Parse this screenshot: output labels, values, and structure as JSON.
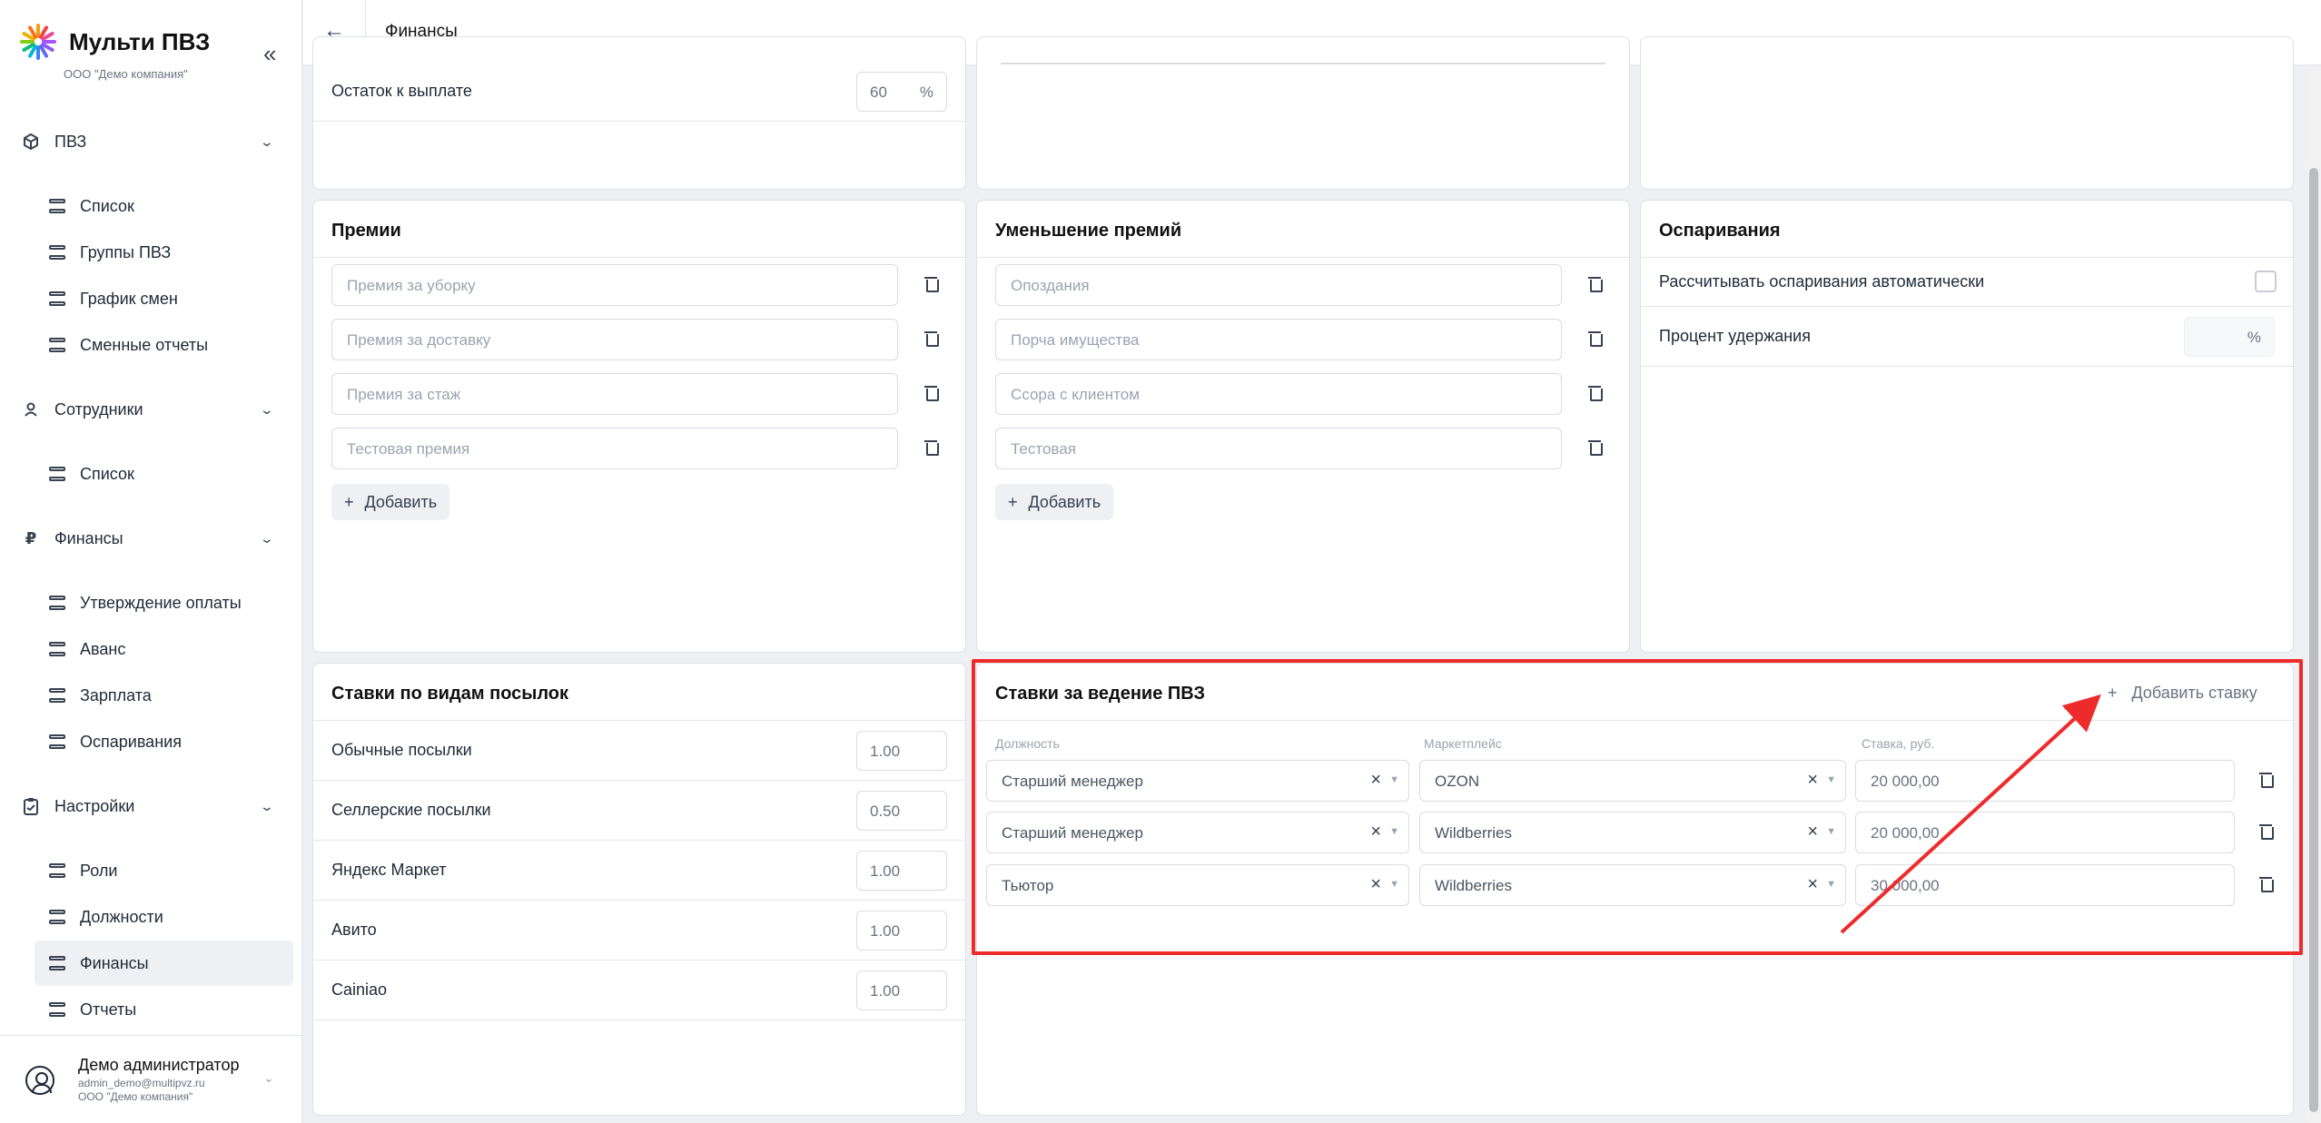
{
  "app": {
    "name": "Мульти ПВЗ",
    "company": "ООО \"Демо компания\"",
    "collapse_icon": "«"
  },
  "sidebar": {
    "sections": [
      {
        "label": "ПВЗ",
        "icon": "cube-icon",
        "items": [
          "Список",
          "Группы ПВЗ",
          "График смен",
          "Сменные отчеты"
        ]
      },
      {
        "label": "Сотрудники",
        "icon": "person-icon",
        "items": [
          "Список"
        ]
      },
      {
        "label": "Финансы",
        "icon": "ruble-icon",
        "items": [
          "Утверждение оплаты",
          "Аванс",
          "Зарплата",
          "Оспаривания"
        ]
      },
      {
        "label": "Настройки",
        "icon": "clipboard-icon",
        "items": [
          "Роли",
          "Должности",
          "Финансы",
          "Отчеты"
        ]
      }
    ],
    "active_item": "Финансы",
    "user": {
      "name": "Демо администратор",
      "email": "admin_demo@multipvz.ru",
      "company": "ООО \"Демо компания\""
    }
  },
  "header": {
    "title": "Финансы"
  },
  "payout_card": {
    "label": "Остаток к выплате",
    "value": "60",
    "unit": "%"
  },
  "bonuses_card": {
    "title": "Премии",
    "items": [
      "Премия за уборку",
      "Премия за доставку",
      "Премия за стаж",
      "Тестовая премия"
    ],
    "add_label": "Добавить"
  },
  "reductions_card": {
    "title": "Уменьшение премий",
    "items": [
      "Опоздания",
      "Порча имущества",
      "Ссора с клиентом",
      "Тестовая"
    ],
    "add_label": "Добавить"
  },
  "disputes_card": {
    "title": "Оспаривания",
    "auto_label": "Рассчитывать оспаривания автоматически",
    "auto_checked": false,
    "retention_label": "Процент удержания",
    "retention_value": "",
    "retention_unit": "%"
  },
  "parcel_rates_card": {
    "title": "Ставки по видам посылок",
    "rows": [
      {
        "label": "Обычные посылки",
        "value": "1.00"
      },
      {
        "label": "Селлерские посылки",
        "value": "0.50"
      },
      {
        "label": "Яндекс Маркет",
        "value": "1.00"
      },
      {
        "label": "Авито",
        "value": "1.00"
      },
      {
        "label": "Cainiao",
        "value": "1.00"
      }
    ]
  },
  "pvz_rates_card": {
    "title": "Ставки за ведение ПВЗ",
    "add_rate_label": "Добавить ставку",
    "columns": [
      "Должность",
      "Маркетплейс",
      "Ставка, руб."
    ],
    "rows": [
      {
        "position": "Старший менеджер",
        "marketplace": "OZON",
        "rate": "20 000,00"
      },
      {
        "position": "Старший менеджер",
        "marketplace": "Wildberries",
        "rate": "20 000,00"
      },
      {
        "position": "Тьютор",
        "marketplace": "Wildberries",
        "rate": "30 000,00"
      }
    ]
  },
  "annotation": {
    "highlight_color": "#ee2b2b"
  }
}
